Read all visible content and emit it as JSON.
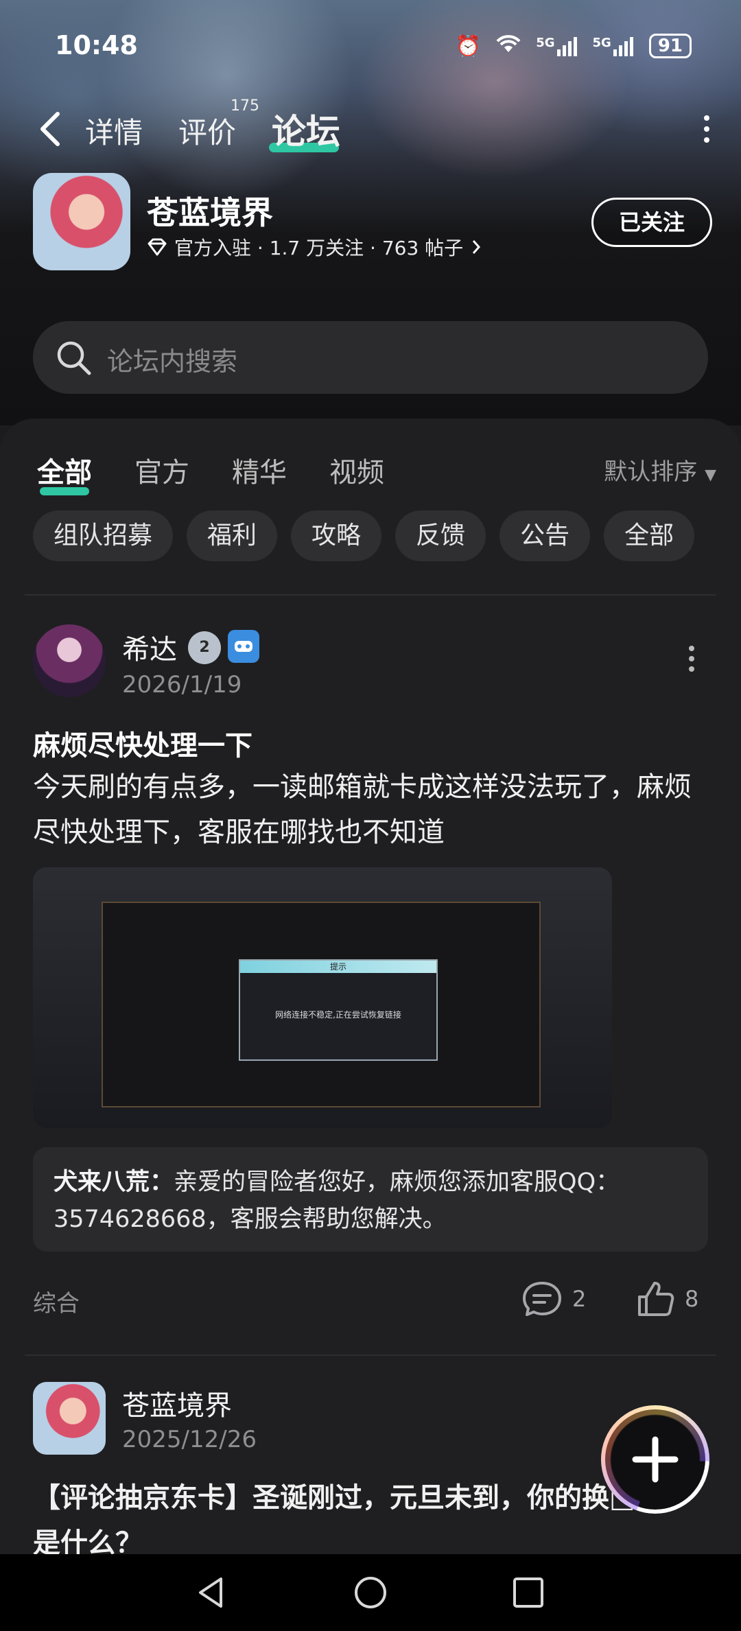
{
  "status_bar": {
    "time": "10:48",
    "network1": "5G",
    "network2": "5G",
    "battery": "91"
  },
  "nav": {
    "tabs": [
      {
        "label": "详情"
      },
      {
        "label": "评价",
        "badge": "175"
      },
      {
        "label": "论坛"
      }
    ]
  },
  "app": {
    "name": "苍蓝境界",
    "meta": "官方入驻 · 1.7 万关注 · 763 帖子",
    "follow_label": "已关注"
  },
  "search": {
    "placeholder": "论坛内搜索"
  },
  "category_tabs": [
    {
      "label": "全部"
    },
    {
      "label": "官方"
    },
    {
      "label": "精华"
    },
    {
      "label": "视频"
    }
  ],
  "sort_label": "默认排序",
  "chips": [
    "组队招募",
    "福利",
    "攻略",
    "反馈",
    "公告",
    "全部"
  ],
  "posts": [
    {
      "author": "希达",
      "level": "2",
      "date": "2026/1/19",
      "title": "麻烦尽快处理一下",
      "body": "今天刷的有点多，一读邮箱就卡成这样没法玩了，麻烦尽快处理下，客服在哪找也不知道",
      "image": {
        "dialog_title": "提示",
        "dialog_message": "网络连接不稳定,正在尝试恢复链接"
      },
      "reply_author": "犬来八荒：",
      "reply_text": "亲爱的冒险者您好，麻烦您添加客服QQ：3574628668，客服会帮助您解决。",
      "tag": "综合",
      "comments": "2",
      "likes": "8"
    },
    {
      "author": "苍蓝境界",
      "date": "2025/12/26",
      "title": "【评论抽京东卡】圣诞刚过，元旦未到，你的换□□子是什么？"
    }
  ]
}
